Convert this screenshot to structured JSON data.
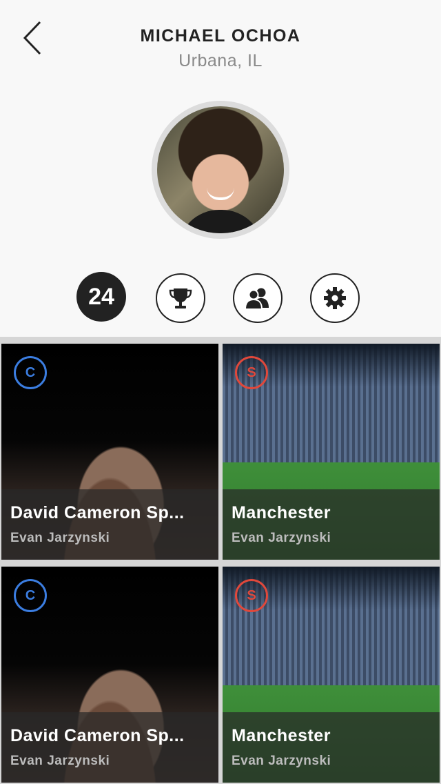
{
  "header": {
    "name": "MICHAEL OCHOA",
    "location": "Urbana, IL"
  },
  "stats": {
    "count": "24",
    "buttons": [
      {
        "icon": "trophy-icon"
      },
      {
        "icon": "friends-icon"
      },
      {
        "icon": "gear-icon"
      }
    ]
  },
  "colors": {
    "badge_c": "#3b7de0",
    "badge_s": "#e0483b"
  },
  "cards": [
    {
      "badge": "C",
      "title": "David Cameron Sp...",
      "author": "Evan Jarzynski",
      "image": "speech"
    },
    {
      "badge": "S",
      "title": "Manchester",
      "author": "Evan Jarzynski",
      "image": "stadium"
    },
    {
      "badge": "C",
      "title": "David Cameron Sp...",
      "author": "Evan Jarzynski",
      "image": "speech"
    },
    {
      "badge": "S",
      "title": "Manchester",
      "author": "Evan Jarzynski",
      "image": "stadium"
    }
  ]
}
